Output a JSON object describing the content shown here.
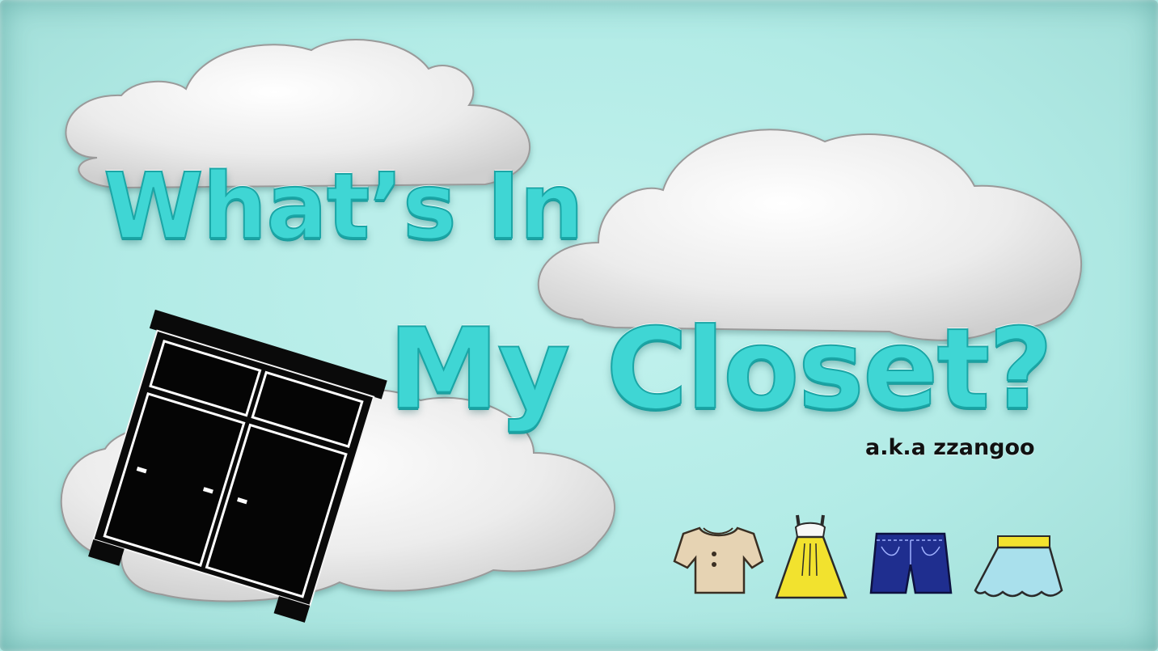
{
  "title": {
    "line1": "What’s In",
    "line2": "My Closet?"
  },
  "subtitle": "a.k.a zzangoo",
  "colors": {
    "background": "#b2ebe6",
    "cloud": "#ededed",
    "title_fill": "#3fd6d4",
    "title_outline": "#1aa6a6",
    "closet": "#0a0a0a",
    "shirt": "#e6d3b3",
    "dress": "#f2e22e",
    "shorts": "#1f2e8f",
    "skirt": "#a9e0ec"
  },
  "icons": [
    "cloud-icon",
    "closet-icon",
    "shirt-icon",
    "dress-icon",
    "shorts-icon",
    "skirt-icon"
  ]
}
